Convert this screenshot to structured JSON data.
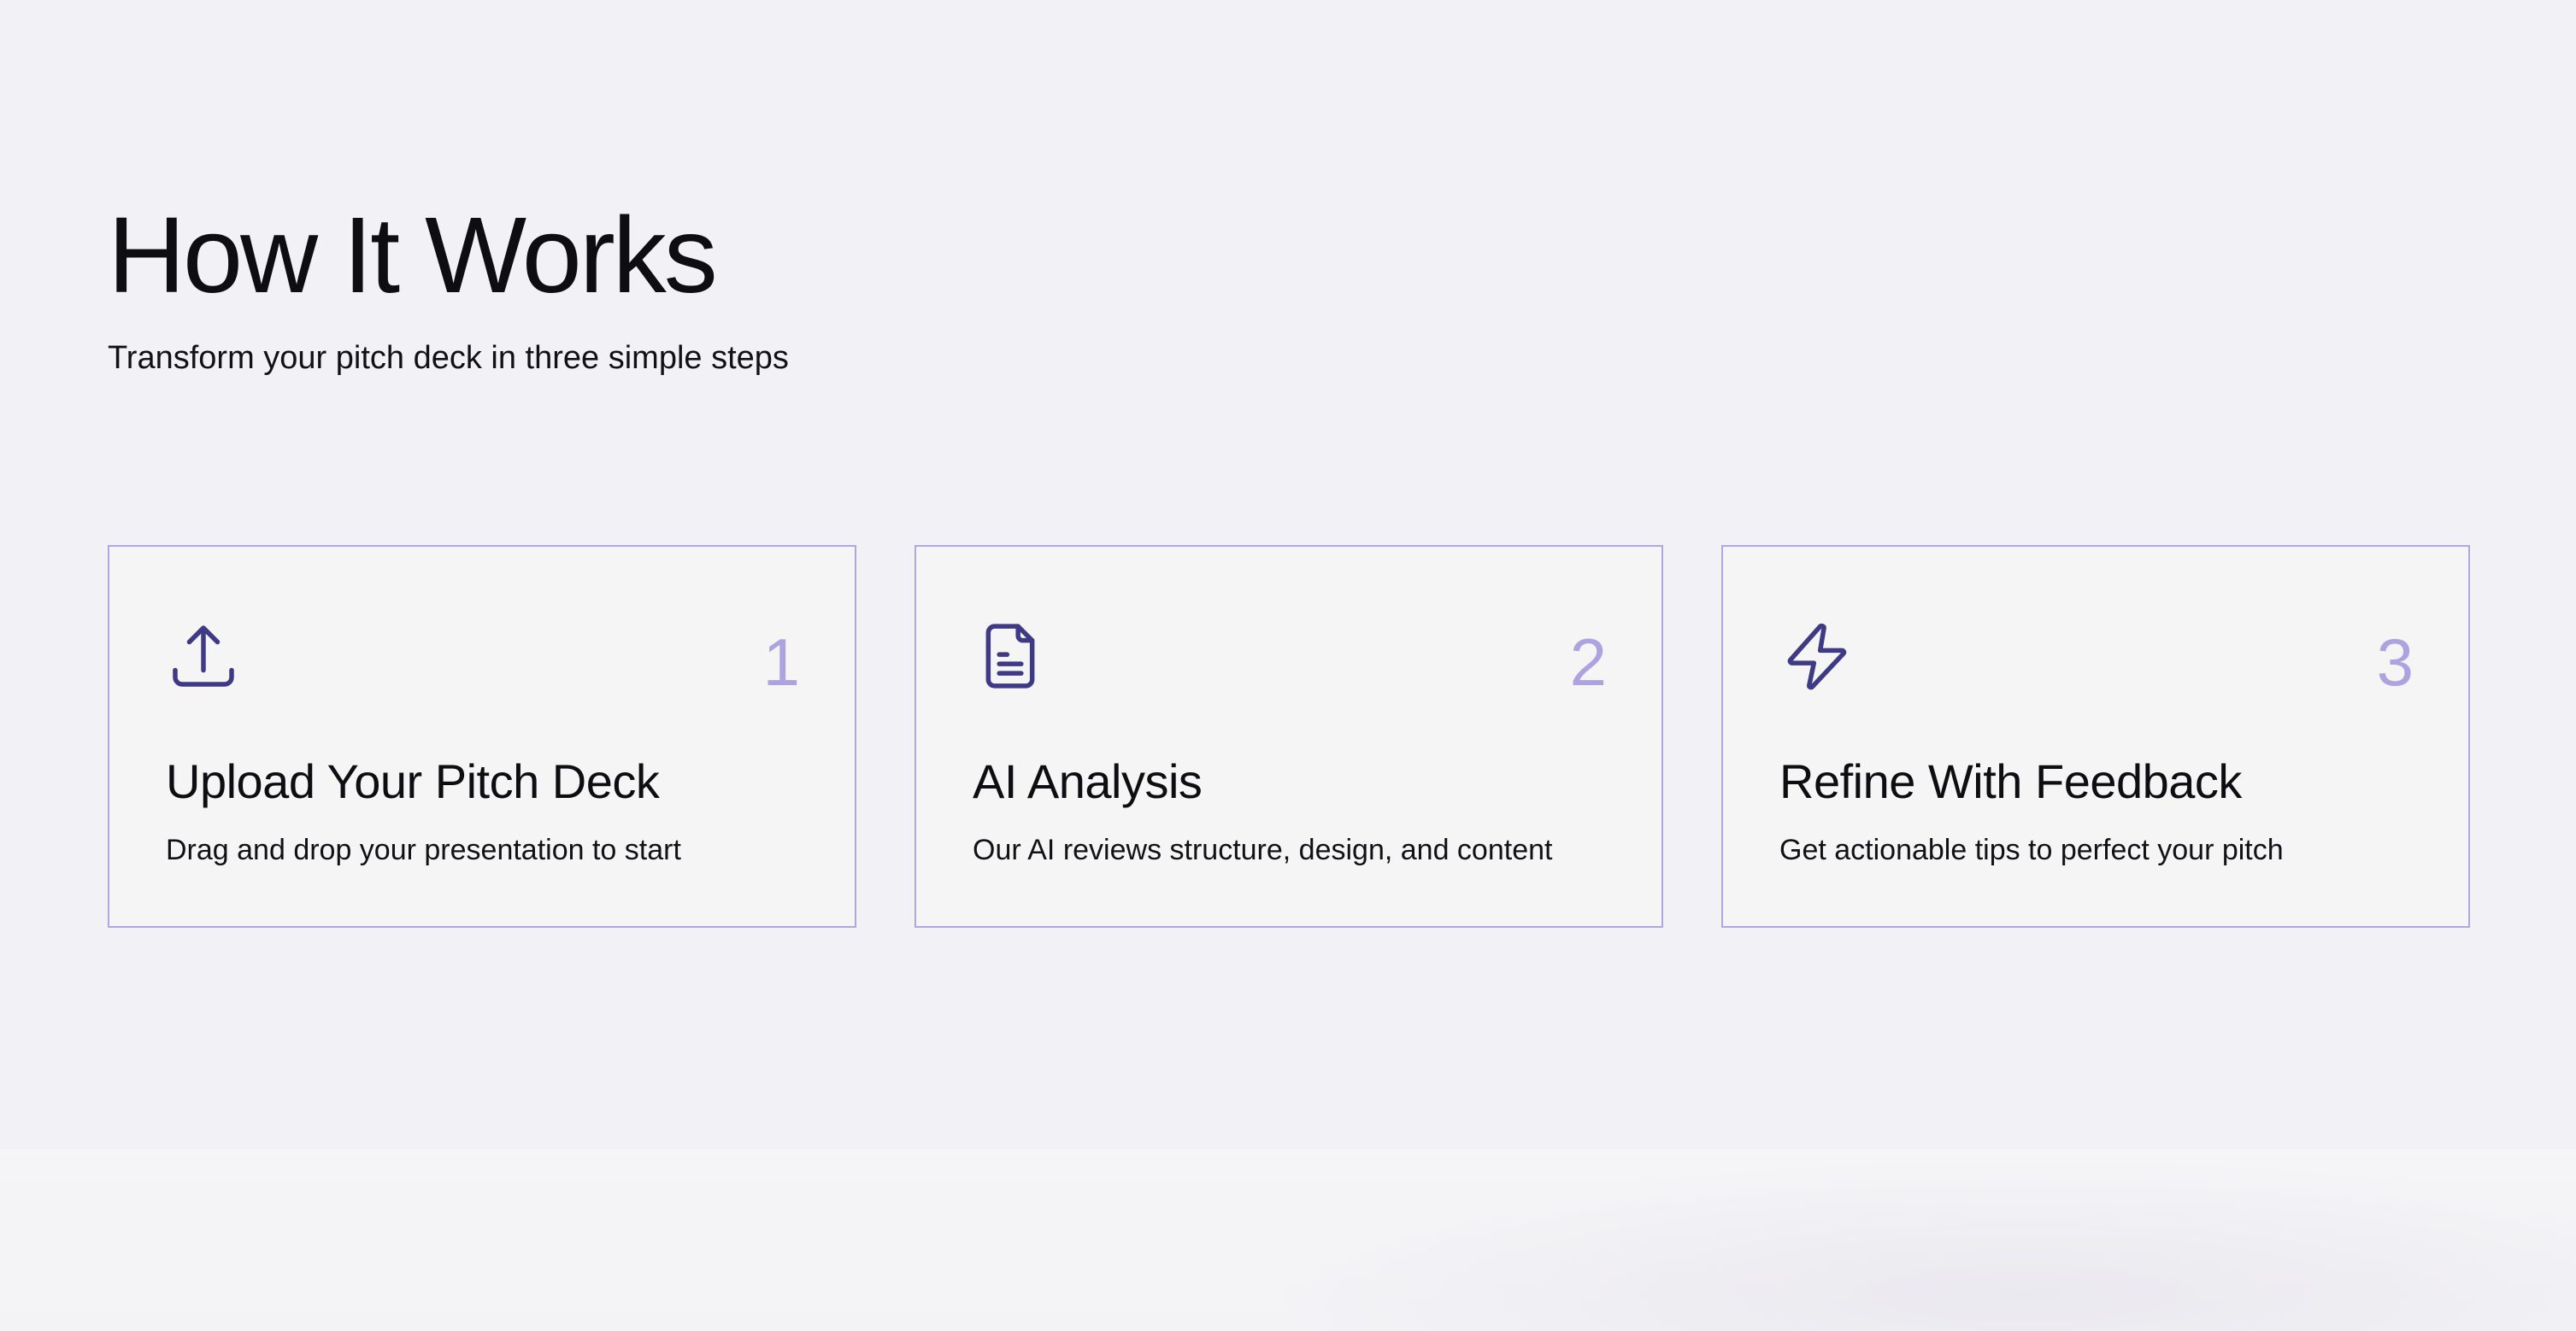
{
  "header": {
    "title": "How It Works",
    "subtitle": "Transform your pitch deck in three simple steps"
  },
  "steps": [
    {
      "icon": "upload-icon",
      "number": "1",
      "title": "Upload Your Pitch Deck",
      "description": "Drag and drop your presentation to start"
    },
    {
      "icon": "document-icon",
      "number": "2",
      "title": "AI Analysis",
      "description": "Our AI reviews structure, design, and content"
    },
    {
      "icon": "lightning-icon",
      "number": "3",
      "title": "Refine With Feedback",
      "description": "Get actionable tips to perfect your pitch"
    }
  ],
  "colors": {
    "background": "#f2f2f6",
    "card_border": "#aea8e2",
    "accent_number": "#aea3e0",
    "icon_stroke": "#3f3a86",
    "text": "#0d0d12"
  }
}
